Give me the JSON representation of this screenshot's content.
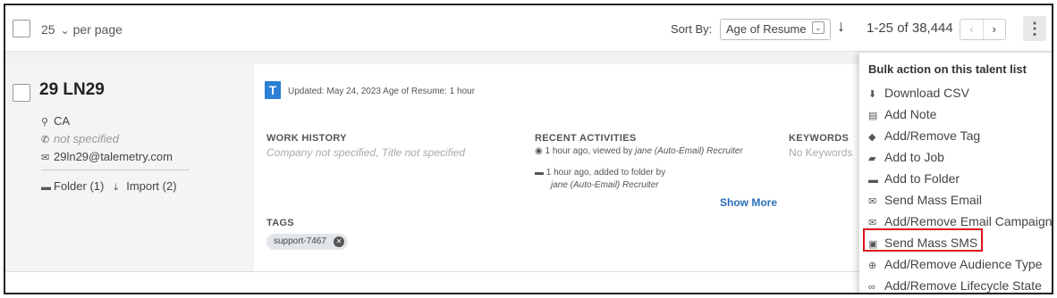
{
  "toolbar": {
    "per_page_value": "25",
    "per_page_label": "per page",
    "sort_label": "Sort By:",
    "sort_value": "Age of Resume",
    "page_count": "1-25 of 38,444"
  },
  "candidate": {
    "name": "29 LN29",
    "location": "CA",
    "phone": "not specified",
    "email": "29ln29@talemetry.com",
    "folder": "Folder (1)",
    "import": "Import (2)",
    "source_badge": "T",
    "updated": "Updated: May 24, 2023  Age of Resume: 1 hour",
    "work_history_heading": "WORK HISTORY",
    "work_history_value": "Company not specified, Title not specified",
    "recent_heading": "RECENT ACTIVITIES",
    "activity1_prefix": "1 hour ago, viewed by ",
    "activity1_user": "jane (Auto-Email) Recruiter",
    "activity2_prefix": "1 hour ago, added to folder by",
    "activity2_user": "jane (Auto-Email) Recruiter",
    "show_more": "Show More",
    "keywords_heading": "KEYWORDS",
    "keywords_value": "No Keywords",
    "tags_heading": "TAGS",
    "tag": "support-7467"
  },
  "menu": {
    "title": "Bulk action on this talent list",
    "items": [
      {
        "label": "Download CSV",
        "icon": "download-icon"
      },
      {
        "label": "Add Note",
        "icon": "note-icon"
      },
      {
        "label": "Add/Remove Tag",
        "icon": "tag-icon"
      },
      {
        "label": "Add to Job",
        "icon": "briefcase-icon"
      },
      {
        "label": "Add to Folder",
        "icon": "folder-icon"
      },
      {
        "label": "Send Mass Email",
        "icon": "email-icon"
      },
      {
        "label": "Add/Remove Email Campaign",
        "icon": "email-campaign-icon"
      },
      {
        "label": "Send Mass SMS",
        "icon": "sms-icon"
      },
      {
        "label": "Add/Remove Audience Type",
        "icon": "audience-icon"
      },
      {
        "label": "Add/Remove Lifecycle State",
        "icon": "infinity-icon"
      }
    ],
    "highlighted_item": "Send Mass SMS"
  },
  "colors": {
    "accent": "#2b7fd4",
    "highlight_border": "#d9141a"
  }
}
